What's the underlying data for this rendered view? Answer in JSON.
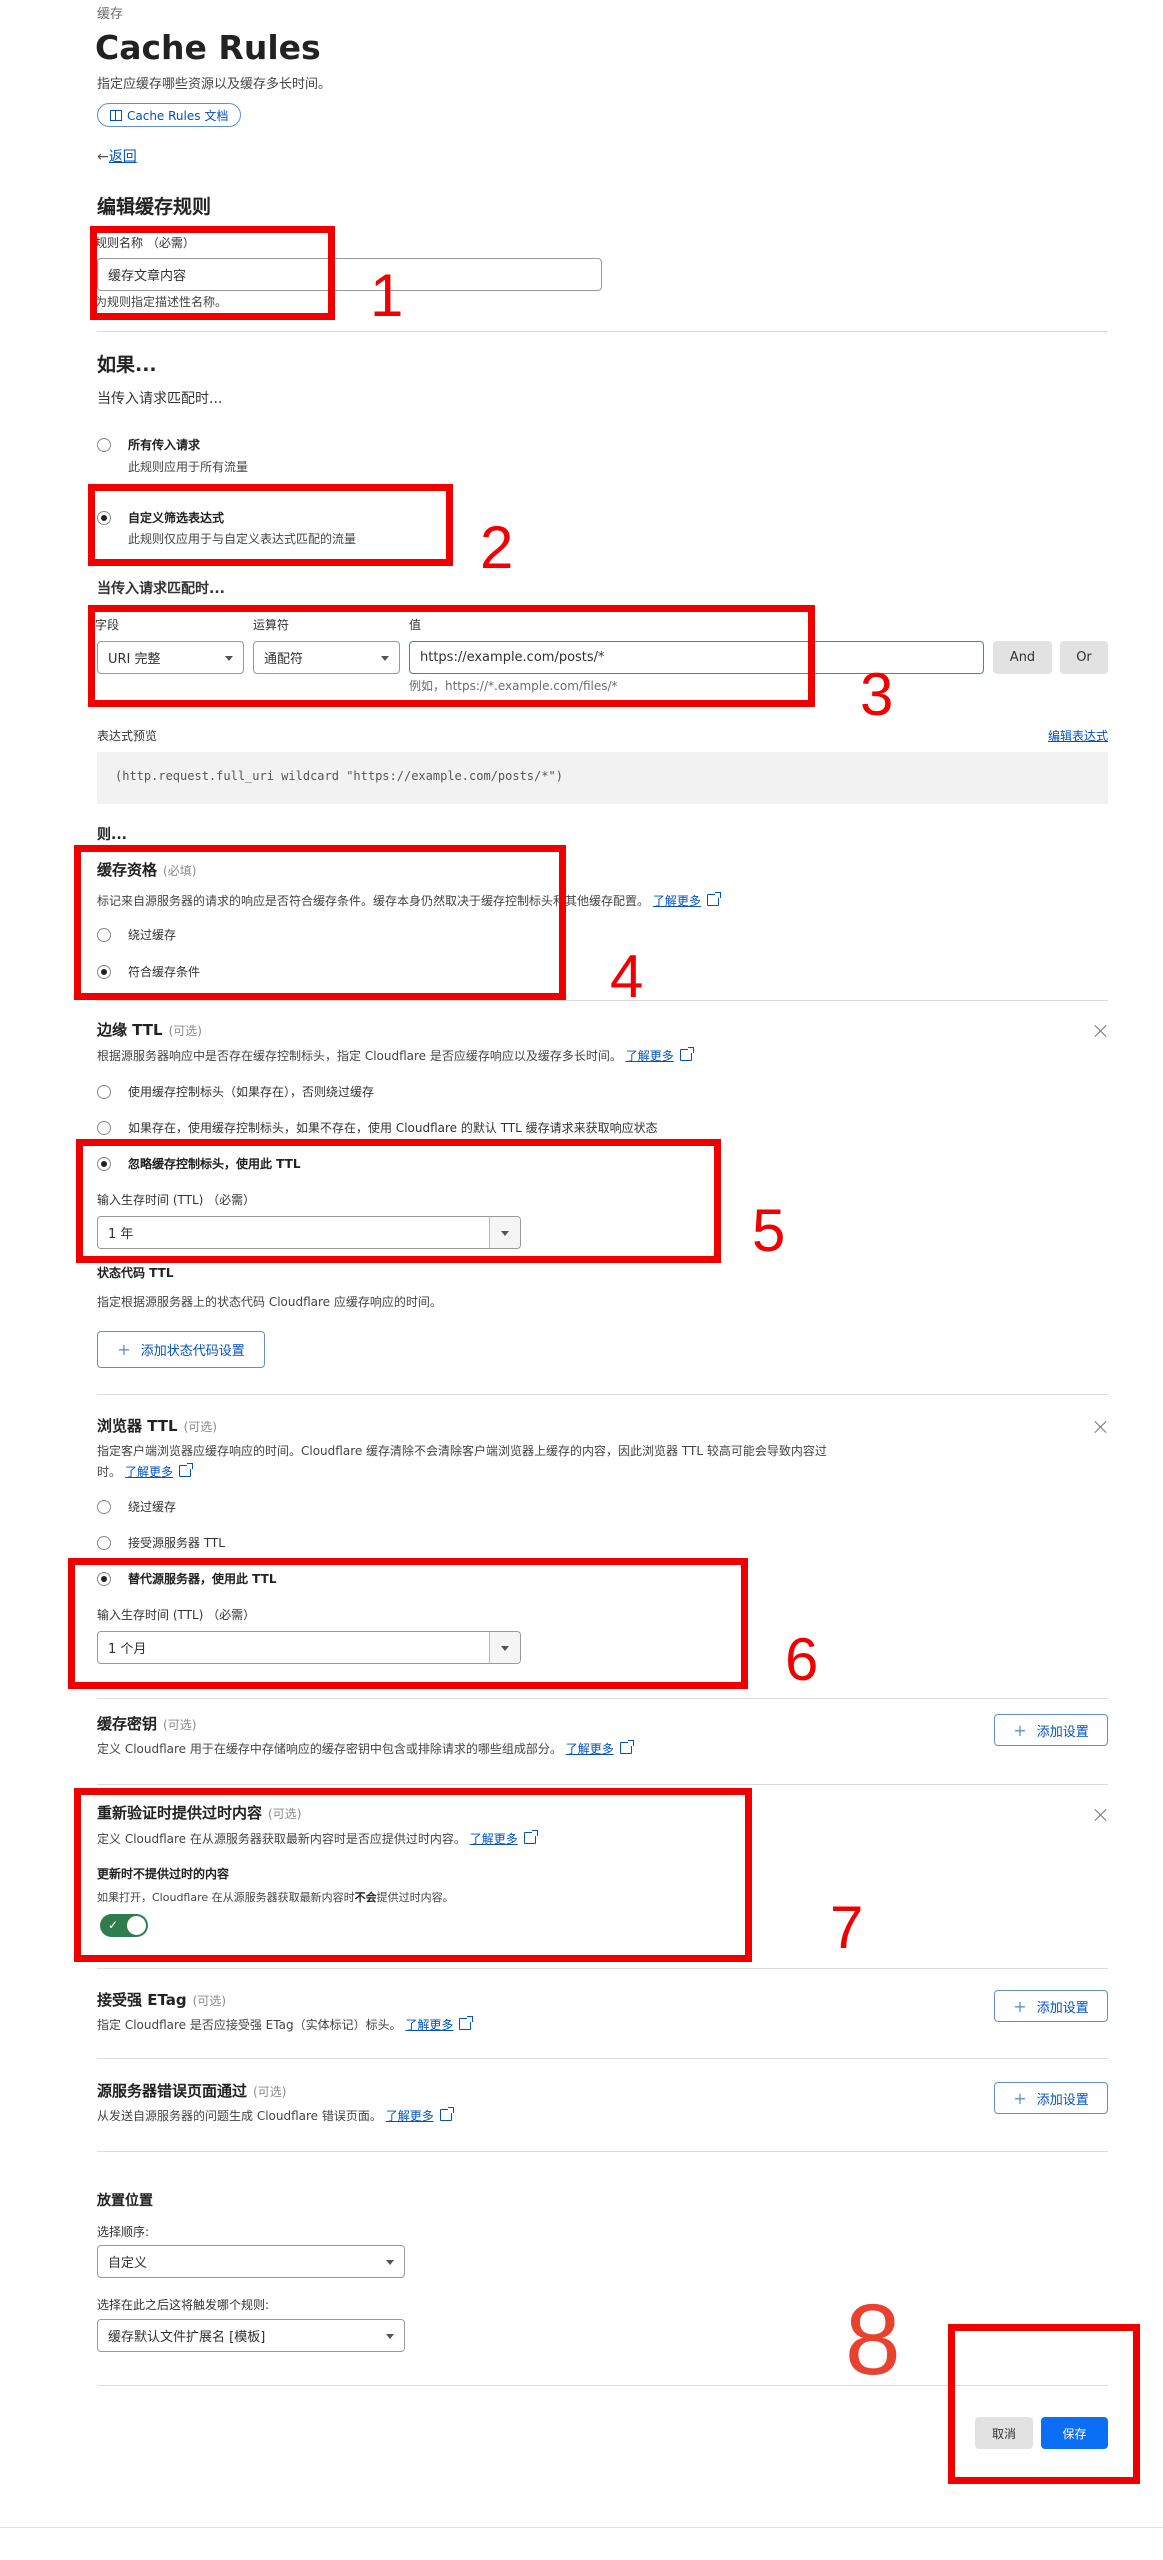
{
  "header": {
    "breadcrumb": "缓存",
    "title": "Cache Rules",
    "description": "指定应缓存哪些资源以及缓存多长时间。",
    "docs_button": "Cache Rules 文档",
    "back_link": "返回",
    "back_arrow": "←"
  },
  "rule_name": {
    "section_title": "编辑缓存规则",
    "label": "规则名称 （必需）",
    "value": "缓存文章内容",
    "hint": "为规则指定描述性名称。"
  },
  "if_section": {
    "title": "如果...",
    "subtitle": "当传入请求匹配时...",
    "options": [
      {
        "label": "所有传入请求",
        "desc": "此规则应用于所有流量",
        "selected": false
      },
      {
        "label": "自定义筛选表达式",
        "desc": "此规则仅应用于与自定义表达式匹配的流量",
        "selected": true
      }
    ]
  },
  "expression": {
    "subtitle": "当传入请求匹配时...",
    "field_label": "字段",
    "operator_label": "运算符",
    "value_label": "值",
    "field_value": "URI 完整",
    "operator_value": "通配符",
    "value": "https://example.com/posts/*",
    "value_hint": "例如，https://*.example.com/files/*",
    "and_button": "And",
    "or_button": "Or",
    "preview_label": "表达式预览",
    "edit_link": "编辑表达式",
    "preview_text": "(http.request.full_uri wildcard \"https://example.com/posts/*\")"
  },
  "then_section": {
    "title": "则..."
  },
  "cache_eligibility": {
    "title": "缓存资格",
    "tag": "(必填)",
    "desc": "标记来自源服务器的请求的响应是否符合缓存条件。缓存本身仍然取决于缓存控制标头和其他缓存配置。",
    "learn_more": "了解更多",
    "options": [
      {
        "label": "绕过缓存",
        "selected": false
      },
      {
        "label": "符合缓存条件",
        "selected": true
      }
    ]
  },
  "edge_ttl": {
    "title": "边缘 TTL",
    "tag": "(可选)",
    "desc": "根据源服务器响应中是否存在缓存控制标头，指定 Cloudflare 是否应缓存响应以及缓存多长时间。",
    "learn_more": "了解更多",
    "options": [
      {
        "label": "使用缓存控制标头（如果存在），否则绕过缓存",
        "selected": false
      },
      {
        "label": "如果存在，使用缓存控制标头，如果不存在，使用 Cloudflare 的默认 TTL 缓存请求来获取响应状态",
        "selected": false
      },
      {
        "label": "忽略缓存控制标头，使用此 TTL",
        "selected": true
      }
    ],
    "ttl_label": "输入生存时间 (TTL) （必需）",
    "ttl_value": "1 年"
  },
  "status_code_ttl": {
    "title": "状态代码 TTL",
    "desc": "指定根据源服务器上的状态代码 Cloudflare 应缓存响应的时间。",
    "button": "添加状态代码设置"
  },
  "browser_ttl": {
    "title": "浏览器 TTL",
    "tag": "(可选)",
    "desc_line1": "指定客户端浏览器应缓存响应的时间。Cloudflare 缓存清除不会清除客户端浏览器上缓存的内容，因此浏览器 TTL 较高可能会导致内容过",
    "desc_line2": "时。",
    "learn_more": "了解更多",
    "options": [
      {
        "label": "绕过缓存",
        "selected": false
      },
      {
        "label": "接受源服务器 TTL",
        "selected": false
      },
      {
        "label": "替代源服务器，使用此 TTL",
        "selected": true
      }
    ],
    "ttl_label": "输入生存时间 (TTL) （必需）",
    "ttl_value": "1 个月"
  },
  "cache_key": {
    "title": "缓存密钥",
    "tag": "(可选)",
    "desc": "定义 Cloudflare 用于在缓存中存储响应的缓存密钥中包含或排除请求的哪些组成部分。",
    "learn_more": "了解更多",
    "button": "添加设置"
  },
  "serve_stale": {
    "title": "重新验证时提供过时内容",
    "tag": "(可选)",
    "desc": "定义 Cloudflare 在从源服务器获取最新内容时是否应提供过时内容。",
    "learn_more": "了解更多",
    "sub_title": "更新时不提供过时的内容",
    "sub_desc_pre": "如果打开，Cloudflare 在从源服务器获取最新内容时",
    "sub_desc_bold": "不会",
    "sub_desc_post": "提供过时内容。",
    "toggle_on": true
  },
  "strong_etag": {
    "title": "接受强 ETag",
    "tag": "(可选)",
    "desc": "指定 Cloudflare 是否应接受强 ETag（实体标记）标头。",
    "learn_more": "了解更多",
    "button": "添加设置"
  },
  "origin_error": {
    "title": "源服务器错误页面通过",
    "tag": "(可选)",
    "desc": "从发送自源服务器的问题生成 Cloudflare 错误页面。",
    "learn_more": "了解更多",
    "button": "添加设置"
  },
  "placement": {
    "title": "放置位置",
    "order_label": "选择顺序:",
    "order_value": "自定义",
    "after_label": "选择在此之后这将触发哪个规则:",
    "after_value": "缓存默认文件扩展名 [模板]"
  },
  "footer": {
    "cancel": "取消",
    "save": "保存"
  },
  "annotations": [
    "1",
    "2",
    "3",
    "4",
    "5",
    "6",
    "7",
    "8"
  ],
  "colors": {
    "accent": "#0b6ff5",
    "link": "#0051c3",
    "toggle_on": "#2f7d4f",
    "annotation": "#f00000"
  }
}
